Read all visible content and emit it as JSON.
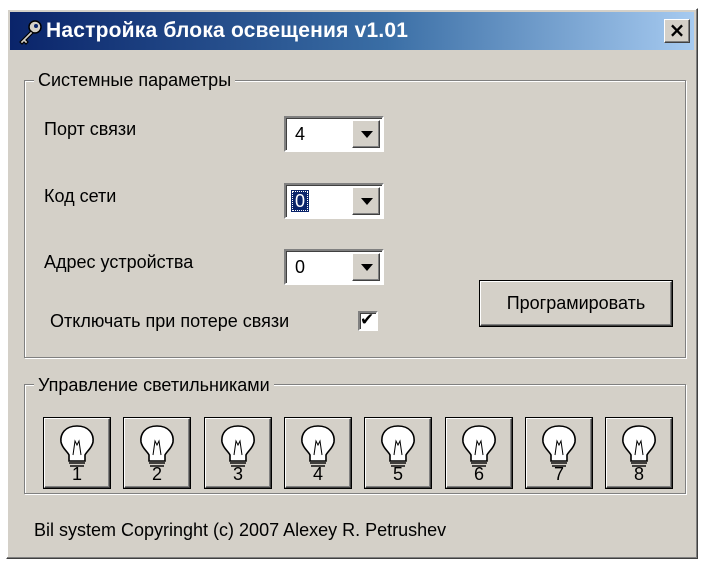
{
  "window": {
    "title": "Настройка блока освещения  v1.01",
    "close_label": "×"
  },
  "system_params": {
    "title": "Системные параметры",
    "port": {
      "label": "Порт связи",
      "value": "4"
    },
    "net_code": {
      "label": "Код сети",
      "value": "0"
    },
    "device_address": {
      "label": "Адрес устройства",
      "value": "0"
    },
    "disconnect_on_loss": {
      "label": "Отключать при потере связи",
      "checked": true,
      "mark": "✔"
    },
    "program_button": "Програмировать"
  },
  "lights": {
    "title": "Управление светильниками",
    "buttons": [
      "1",
      "2",
      "3",
      "4",
      "5",
      "6",
      "7",
      "8"
    ]
  },
  "footer": "Bil system Copyringht (c) 2007 Alexey R. Petrushev",
  "colors": {
    "face": "#d4d0c8",
    "title_start": "#0a246a",
    "title_end": "#a6caf0",
    "selection": "#0a246a"
  },
  "icons": {
    "title": "key-icon",
    "lamp": "light-bulb-icon",
    "dropdown": "chevron-down-icon"
  }
}
